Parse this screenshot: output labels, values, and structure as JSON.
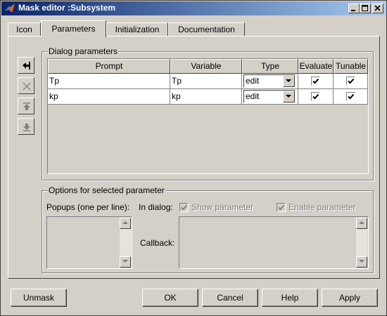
{
  "window": {
    "title": "Mask editor :Subsystem",
    "controls": [
      "minimize-icon",
      "maximize-icon",
      "close-icon"
    ]
  },
  "tabs": [
    {
      "label": "Icon",
      "active": false
    },
    {
      "label": "Parameters",
      "active": true
    },
    {
      "label": "Initialization",
      "active": false
    },
    {
      "label": "Documentation",
      "active": false
    }
  ],
  "dialog_parameters": {
    "group_label": "Dialog parameters",
    "side_buttons": [
      "add-parameter-icon",
      "delete-icon",
      "move-up-icon",
      "move-down-icon"
    ],
    "columns": [
      "Prompt",
      "Variable",
      "Type",
      "Evaluate",
      "Tunable"
    ],
    "rows": [
      {
        "prompt": "Tp",
        "variable": "Tp",
        "type": "edit",
        "evaluate": true,
        "tunable": true
      },
      {
        "prompt": "kp",
        "variable": "kp",
        "type": "edit",
        "evaluate": true,
        "tunable": true
      }
    ]
  },
  "options": {
    "group_label": "Options for selected parameter",
    "popups_label": "Popups (one per line):",
    "in_dialog_label": "In dialog:",
    "show_parameter_label": "Show parameter",
    "enable_parameter_label": "Enable parameter",
    "callback_label": "Callback:"
  },
  "buttons": {
    "unmask": "Unmask",
    "ok": "OK",
    "cancel": "Cancel",
    "help": "Help",
    "apply": "Apply"
  },
  "colors": {
    "title_start": "#0a246a",
    "title_end": "#a6caf0",
    "face": "#d4d0c8"
  }
}
